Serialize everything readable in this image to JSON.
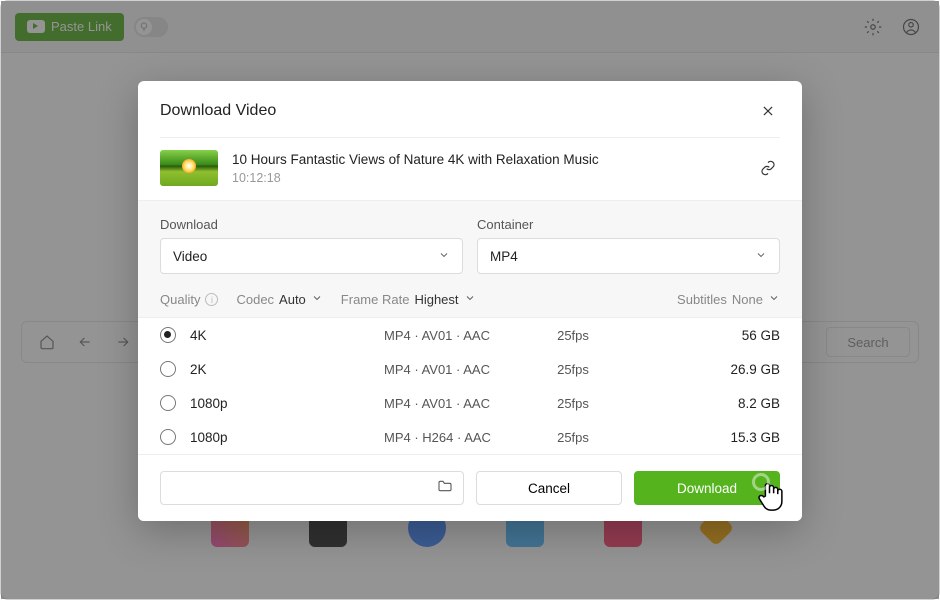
{
  "header": {
    "paste_link_label": "Paste Link"
  },
  "browser": {
    "search_label": "Search"
  },
  "modal": {
    "title": "Download Video",
    "video": {
      "title": "10 Hours Fantastic Views of Nature 4K with Relaxation Music",
      "duration": "10:12:18"
    },
    "download_type": {
      "label": "Download",
      "value": "Video"
    },
    "container": {
      "label": "Container",
      "value": "MP4"
    },
    "filters": {
      "quality_label": "Quality",
      "codec_label": "Codec",
      "codec_value": "Auto",
      "framerate_label": "Frame Rate",
      "framerate_value": "Highest",
      "subtitles_label": "Subtitles",
      "subtitles_value": "None"
    },
    "quality_options": [
      {
        "name": "4K",
        "format": "MP4 · AV01 · AAC",
        "fps": "25fps",
        "size": "56 GB",
        "selected": true
      },
      {
        "name": "2K",
        "format": "MP4 · AV01 · AAC",
        "fps": "25fps",
        "size": "26.9 GB",
        "selected": false
      },
      {
        "name": "1080p",
        "format": "MP4 · AV01 · AAC",
        "fps": "25fps",
        "size": "8.2 GB",
        "selected": false
      },
      {
        "name": "1080p",
        "format": "MP4 · H264 · AAC",
        "fps": "25fps",
        "size": "15.3 GB",
        "selected": false
      }
    ],
    "footer": {
      "cancel_label": "Cancel",
      "download_label": "Download"
    }
  }
}
